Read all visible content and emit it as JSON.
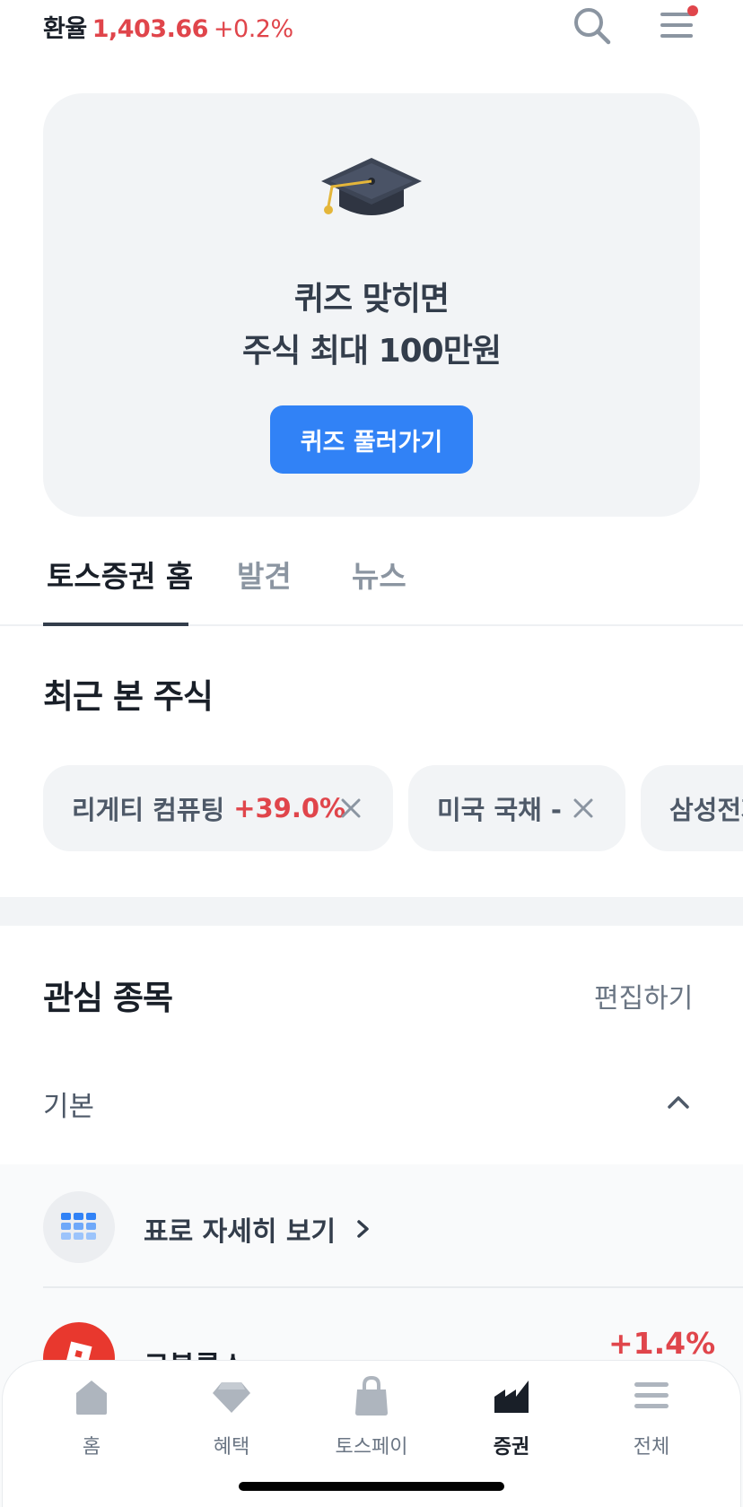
{
  "header": {
    "fx_label": "환율",
    "fx_value": "1,403.66",
    "fx_change": "+0.2%",
    "icons": [
      "search-icon",
      "menu-icon"
    ]
  },
  "banner": {
    "line1": "퀴즈 맞히면",
    "line2": "주식 최대 100만원",
    "button_label": "퀴즈 풀러가기",
    "icon": "graduation-cap-icon"
  },
  "tabs": [
    {
      "label": "토스증권 홈",
      "active": true
    },
    {
      "label": "발견",
      "active": false
    },
    {
      "label": "뉴스",
      "active": false
    }
  ],
  "recent": {
    "title": "최근 본 주식",
    "chips": [
      {
        "name": "리게티 컴퓨팅",
        "change": "+39.0%"
      },
      {
        "name": "미국 국채 -",
        "change": ""
      },
      {
        "name": "삼성전자",
        "change": ""
      }
    ]
  },
  "watchlist": {
    "title": "관심 종목",
    "edit_label": "편집하기",
    "group_label": "기본",
    "table_view_label": "표로 자세히 보기",
    "stocks": [
      {
        "name": "로블록스",
        "change": "+1.4%"
      }
    ]
  },
  "bottom_nav": [
    {
      "label": "홈",
      "icon": "home-icon",
      "active": false
    },
    {
      "label": "혜택",
      "icon": "diamond-icon",
      "active": false
    },
    {
      "label": "토스페이",
      "icon": "shopping-bag-icon",
      "active": false
    },
    {
      "label": "증권",
      "icon": "stocks-icon",
      "active": true
    },
    {
      "label": "전체",
      "icon": "menu-icon",
      "active": false
    }
  ],
  "colors": {
    "accent": "#3182f6",
    "up": "#e0454b",
    "text": "#191f28",
    "muted": "#8b95a1",
    "card_bg": "#f2f4f6"
  }
}
